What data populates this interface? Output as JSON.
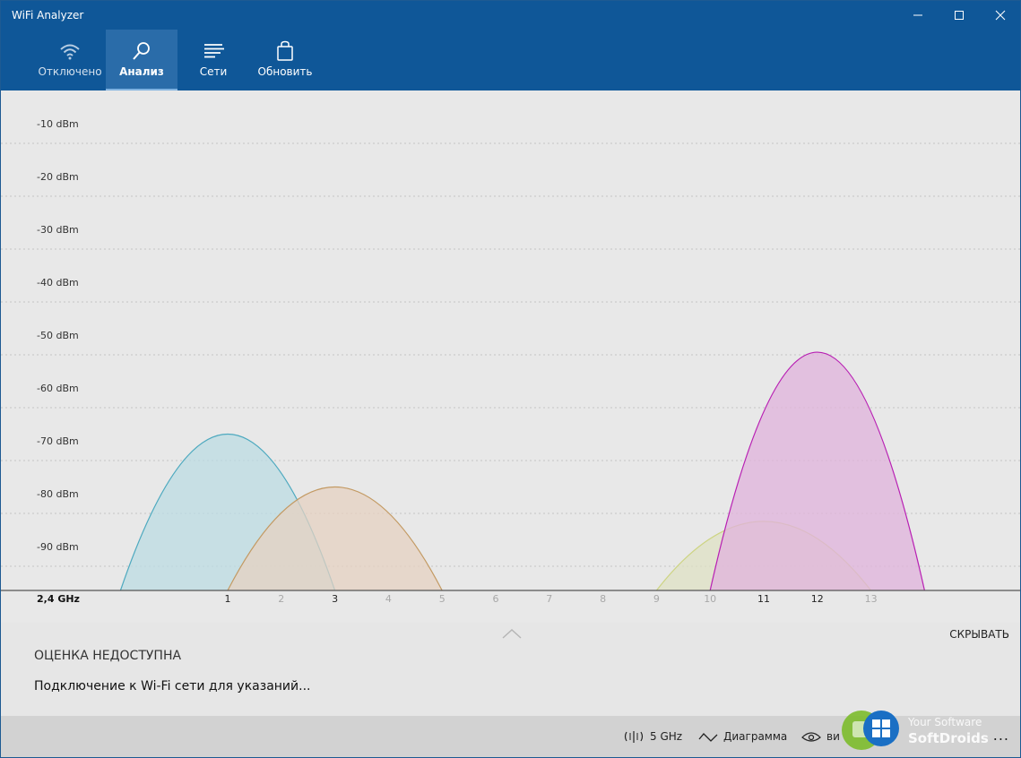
{
  "window": {
    "title": "WiFi Analyzer"
  },
  "nav": {
    "tabs": [
      {
        "id": "disconnected",
        "label": "Отключено",
        "icon": "wifi-icon",
        "state": "disabled"
      },
      {
        "id": "analyze",
        "label": "Анализ",
        "icon": "magnifier-icon",
        "state": "active"
      },
      {
        "id": "networks",
        "label": "Сети",
        "icon": "list-icon",
        "state": "normal"
      },
      {
        "id": "refresh",
        "label": "Обновить",
        "icon": "bag-icon",
        "state": "normal"
      }
    ]
  },
  "chart_data": {
    "type": "area",
    "band_label": "2,4 GHz",
    "y_ticks": [
      "-10 dBm",
      "-20 dBm",
      "-30 dBm",
      "-40 dBm",
      "-50 dBm",
      "-60 dBm",
      "-70 dBm",
      "-80 dBm",
      "-90 dBm"
    ],
    "y_tick_values": [
      -10,
      -20,
      -30,
      -40,
      -50,
      -60,
      -70,
      -80,
      -90
    ],
    "ylim": [
      -100,
      0
    ],
    "x_channels": [
      "1",
      "2",
      "3",
      "4",
      "5",
      "6",
      "7",
      "8",
      "9",
      "10",
      "11",
      "12",
      "13"
    ],
    "highlighted_channels": [
      "1",
      "3",
      "11",
      "12"
    ],
    "xlim": [
      -1,
      15
    ],
    "grid": true,
    "networks": [
      {
        "channel": 1,
        "width": 4,
        "peak_dbm": -65,
        "stroke": "#4da9bf",
        "fill": "#bcdce3"
      },
      {
        "channel": 3,
        "width": 4,
        "peak_dbm": -75,
        "stroke": "#c39a63",
        "fill": "#e5d2c1"
      },
      {
        "channel": 11,
        "width": 4,
        "peak_dbm": -81.5,
        "stroke": "#cdd483",
        "fill": "#dfe2c4"
      },
      {
        "channel": 12,
        "width": 4,
        "peak_dbm": -49.5,
        "stroke": "#b81fb3",
        "fill": "#e0b3dc"
      }
    ]
  },
  "panel": {
    "hide_label": "СКРЫВАТЬ",
    "rating_text": "ОЦЕНКА НЕДОСТУПНА",
    "connect_msg": "Подключение к Wi-Fi сети для указаний..."
  },
  "bottom_bar": {
    "band_5ghz_label": "5 GHz",
    "diagram_label": "Диаграмма",
    "view_label": "ви",
    "more_label": "..."
  },
  "watermark": {
    "line1": "Your Software",
    "line2": "SoftDroids"
  }
}
